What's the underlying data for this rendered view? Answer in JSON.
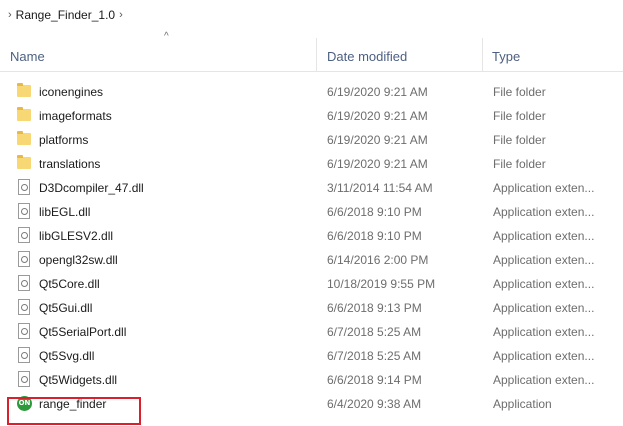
{
  "breadcrumb": {
    "items": [
      {
        "label": "Range_Finder_1.0"
      }
    ],
    "separator": "›"
  },
  "header": {
    "sort_arrow": "^",
    "columns": [
      {
        "label": "Name"
      },
      {
        "label": "Date modified"
      },
      {
        "label": "Type"
      }
    ]
  },
  "files": [
    {
      "name": "iconengines",
      "date": "6/19/2020 9:21 AM",
      "type": "File folder",
      "icon": "folder-icon"
    },
    {
      "name": "imageformats",
      "date": "6/19/2020 9:21 AM",
      "type": "File folder",
      "icon": "folder-icon"
    },
    {
      "name": "platforms",
      "date": "6/19/2020 9:21 AM",
      "type": "File folder",
      "icon": "folder-icon"
    },
    {
      "name": "translations",
      "date": "6/19/2020 9:21 AM",
      "type": "File folder",
      "icon": "folder-icon"
    },
    {
      "name": "D3Dcompiler_47.dll",
      "date": "3/11/2014 11:54 AM",
      "type": "Application exten...",
      "icon": "dll-file-icon"
    },
    {
      "name": "libEGL.dll",
      "date": "6/6/2018 9:10 PM",
      "type": "Application exten...",
      "icon": "dll-file-icon"
    },
    {
      "name": "libGLESV2.dll",
      "date": "6/6/2018 9:10 PM",
      "type": "Application exten...",
      "icon": "dll-file-icon"
    },
    {
      "name": "opengl32sw.dll",
      "date": "6/14/2016 2:00 PM",
      "type": "Application exten...",
      "icon": "dll-file-icon"
    },
    {
      "name": "Qt5Core.dll",
      "date": "10/18/2019 9:55 PM",
      "type": "Application exten...",
      "icon": "dll-file-icon"
    },
    {
      "name": "Qt5Gui.dll",
      "date": "6/6/2018 9:13 PM",
      "type": "Application exten...",
      "icon": "dll-file-icon"
    },
    {
      "name": "Qt5SerialPort.dll",
      "date": "6/7/2018 5:25 AM",
      "type": "Application exten...",
      "icon": "dll-file-icon"
    },
    {
      "name": "Qt5Svg.dll",
      "date": "6/7/2018 5:25 AM",
      "type": "Application exten...",
      "icon": "dll-file-icon"
    },
    {
      "name": "Qt5Widgets.dll",
      "date": "6/6/2018 9:14 PM",
      "type": "Application exten...",
      "icon": "dll-file-icon"
    },
    {
      "name": "range_finder",
      "date": "6/4/2020 9:38 AM",
      "type": "Application",
      "icon": "on-semi-app-icon",
      "app_icon_text": "ON"
    }
  ],
  "colors": {
    "header_text": "#4d6082",
    "meta_text": "#6d6d6d",
    "folder": "#f8d775",
    "app_icon": "#2c9a3b",
    "highlight_border": "#d9202c"
  }
}
